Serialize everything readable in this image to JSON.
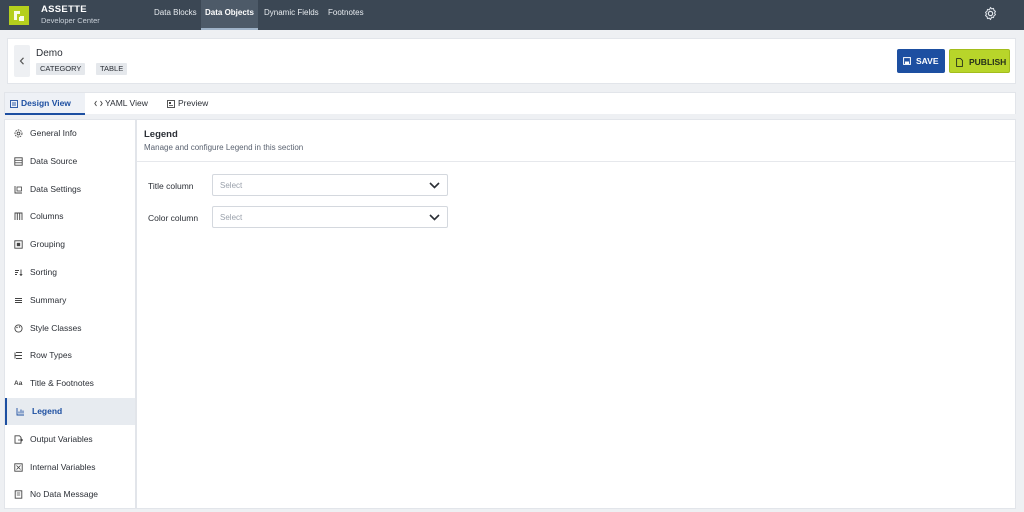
{
  "brand": {
    "title": "ASSETTE",
    "subtitle": "Developer Center"
  },
  "nav": [
    {
      "label": "Data Blocks",
      "active": false
    },
    {
      "label": "Data Objects",
      "active": true
    },
    {
      "label": "Dynamic Fields",
      "active": false
    },
    {
      "label": "Footnotes",
      "active": false
    }
  ],
  "header": {
    "title": "Demo",
    "tags": [
      "CATEGORY",
      "TABLE"
    ],
    "save_label": "SAVE",
    "publish_label": "PUBLISH"
  },
  "tabs": [
    {
      "label": "Design View",
      "icon": "design-icon",
      "active": true
    },
    {
      "label": "YAML View",
      "icon": "code-icon",
      "active": false
    },
    {
      "label": "Preview",
      "icon": "preview-icon",
      "active": false
    }
  ],
  "sidebar": {
    "items": [
      {
        "label": "General Info",
        "icon": "gear-icon"
      },
      {
        "label": "Data Source",
        "icon": "database-icon"
      },
      {
        "label": "Data Settings",
        "icon": "settings-icon"
      },
      {
        "label": "Columns",
        "icon": "columns-icon"
      },
      {
        "label": "Grouping",
        "icon": "grouping-icon"
      },
      {
        "label": "Sorting",
        "icon": "sort-icon"
      },
      {
        "label": "Summary",
        "icon": "summary-icon"
      },
      {
        "label": "Style Classes",
        "icon": "palette-icon"
      },
      {
        "label": "Row Types",
        "icon": "rows-icon"
      },
      {
        "label": "Title & Footnotes",
        "icon": "text-icon"
      },
      {
        "label": "Legend",
        "icon": "legend-icon",
        "active": true
      },
      {
        "label": "Output Variables",
        "icon": "output-icon"
      },
      {
        "label": "Internal Variables",
        "icon": "variables-icon"
      },
      {
        "label": "No Data Message",
        "icon": "message-icon"
      }
    ]
  },
  "section": {
    "title": "Legend",
    "description": "Manage and configure Legend in this section",
    "fields": [
      {
        "label": "Title column",
        "placeholder": "Select"
      },
      {
        "label": "Color column",
        "placeholder": "Select"
      }
    ]
  },
  "colors": {
    "topbar": "#3b4754",
    "accent": "#1d4fa1",
    "publish": "#b8d52a",
    "logo": "#b5cf1d"
  }
}
